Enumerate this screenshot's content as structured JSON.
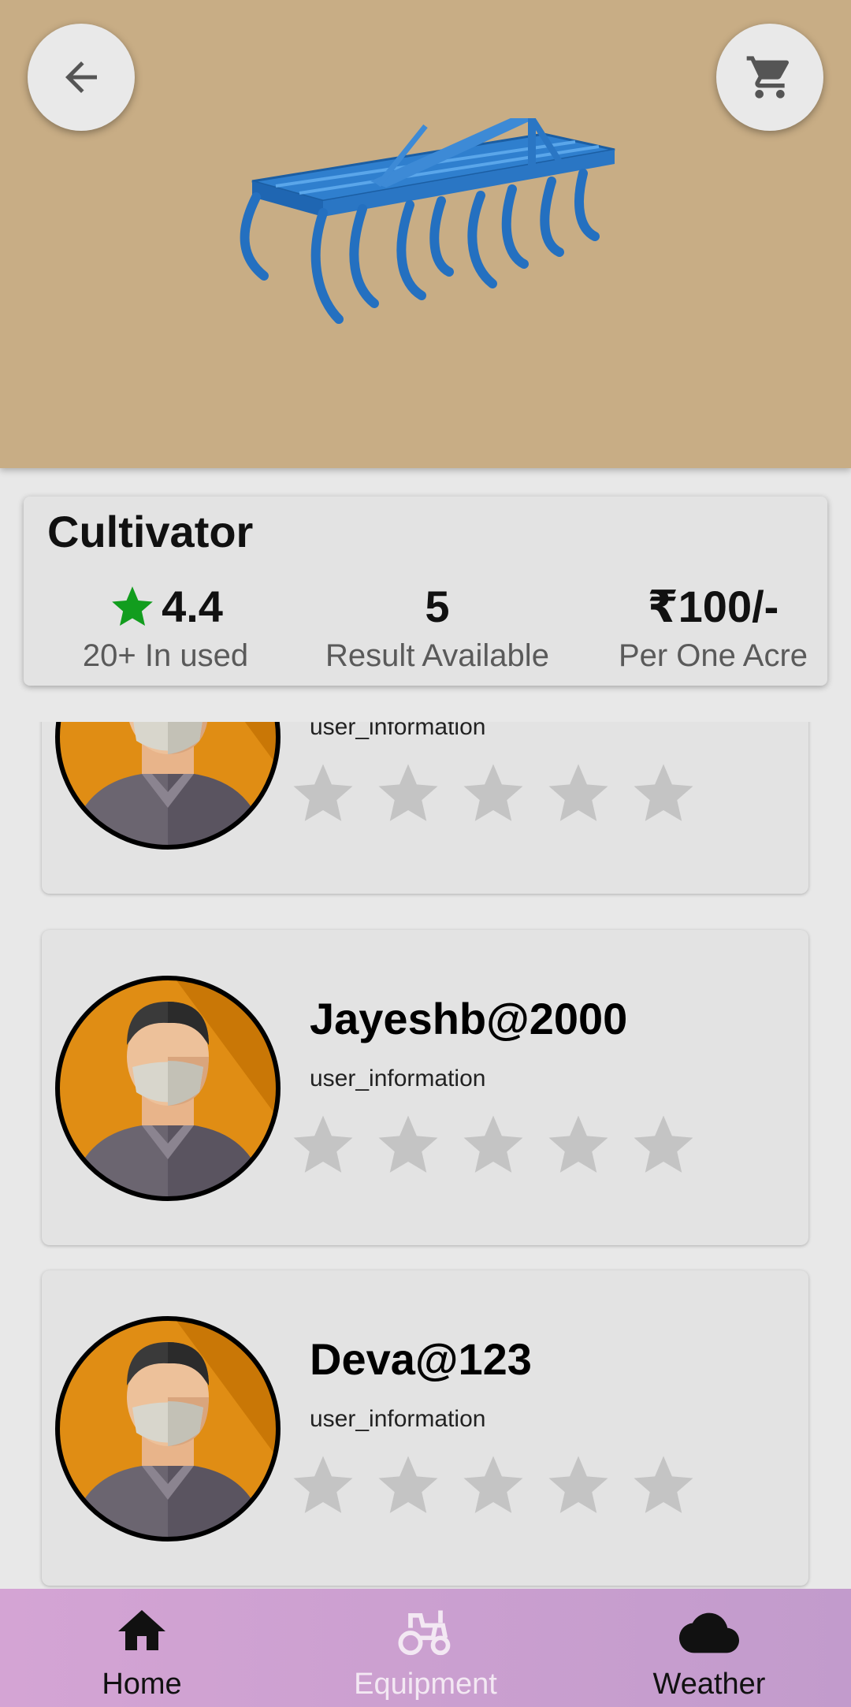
{
  "product": {
    "title": "Cultivator",
    "rating": "4.4",
    "used_label": "20+ In used",
    "results_count": "5",
    "results_label": "Result Available",
    "price": "₹100/-",
    "price_label": "Per One Acre"
  },
  "reviews": [
    {
      "name": "",
      "info": "user_information",
      "stars": 0
    },
    {
      "name": "Jayeshb@2000",
      "info": "user_information",
      "stars": 0
    },
    {
      "name": "Deva@123",
      "info": "user_information",
      "stars": 0
    }
  ],
  "nav": {
    "home": "Home",
    "equipment": "Equipment",
    "weather": "Weather"
  },
  "colors": {
    "hero_bg": "#c8ad85",
    "star_green": "#129d1e",
    "star_empty": "#c4c4c4",
    "nav_active": "#111111",
    "nav_inactive": "#f3e8f3"
  }
}
